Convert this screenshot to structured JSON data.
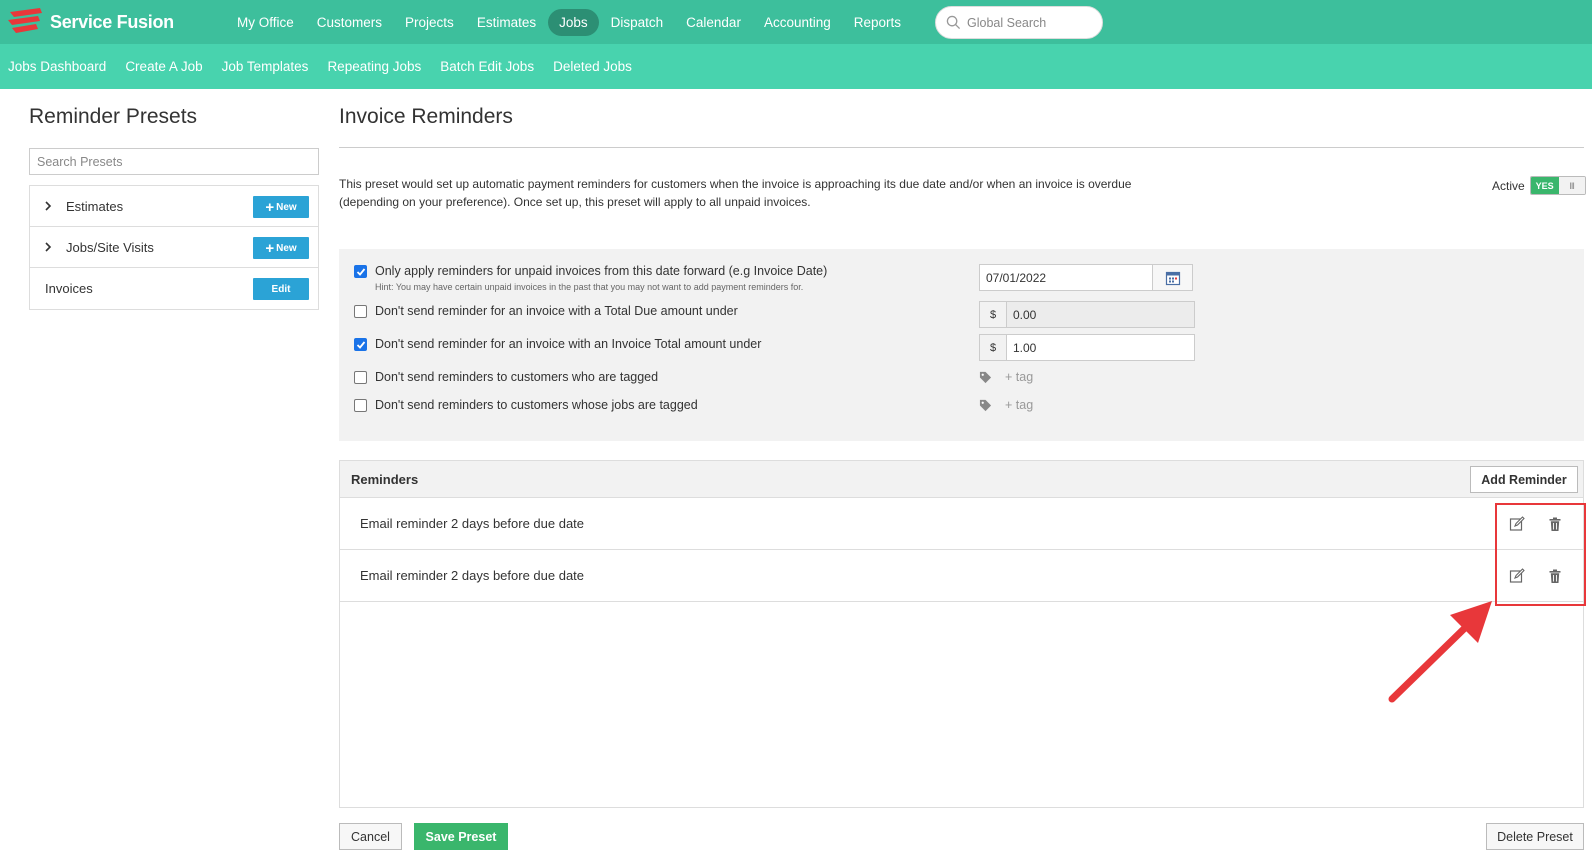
{
  "brand": {
    "name": "Service Fusion",
    "logo_icon": "service-fusion-logo",
    "accent": "#3dbf9c",
    "accent_light": "#48d3ae",
    "nav_active": "#2c8f74"
  },
  "main_nav": {
    "items": [
      "My Office",
      "Customers",
      "Projects",
      "Estimates",
      "Jobs",
      "Dispatch",
      "Calendar",
      "Accounting",
      "Reports"
    ],
    "active": "Jobs"
  },
  "global_search": {
    "placeholder": "Global Search",
    "icon": "search-icon"
  },
  "sub_nav": {
    "items": [
      "Jobs Dashboard",
      "Create A Job",
      "Job Templates",
      "Repeating Jobs",
      "Batch Edit Jobs",
      "Deleted Jobs"
    ]
  },
  "left_panel": {
    "title": "Reminder Presets",
    "search_placeholder": "Search Presets",
    "presets": [
      {
        "label": "Estimates",
        "expandable": true,
        "button": "New"
      },
      {
        "label": "Jobs/Site Visits",
        "expandable": true,
        "button": "New"
      },
      {
        "label": "Invoices",
        "expandable": false,
        "button": "Edit"
      }
    ]
  },
  "main": {
    "title": "Invoice Reminders",
    "description": "This preset would set up automatic payment reminders for customers when the invoice is approaching its due date and/or when an invoice is overdue (depending on your preference). Once set up, this preset will apply to all unpaid invoices.",
    "active_label": "Active",
    "active_toggle": "YES",
    "active_toggle_grip": "III",
    "options": [
      {
        "label": "Only apply reminders for unpaid invoices from this date forward (e.g Invoice Date)",
        "checked": true,
        "hint": "Hint: You may have certain unpaid invoices in the past that you may not want to add payment reminders for."
      },
      {
        "label": "Don't send reminder for an invoice with a Total Due amount under",
        "checked": false
      },
      {
        "label": "Don't send reminder for an invoice with an Invoice Total amount under",
        "checked": true
      },
      {
        "label": "Don't send reminders to customers who are tagged",
        "checked": false
      },
      {
        "label": "Don't send reminders to customers whose jobs are tagged",
        "checked": false
      }
    ],
    "date_value": "07/01/2022",
    "currency_symbol": "$",
    "total_due_value": "0.00",
    "invoice_total_value": "1.00",
    "tag_add_label": "+ tag",
    "reminders": {
      "title": "Reminders",
      "add_label": "Add Reminder",
      "rows": [
        "Email reminder 2 days before due date",
        "Email reminder 2 days before due date"
      ]
    },
    "footer": {
      "cancel": "Cancel",
      "save": "Save Preset",
      "delete": "Delete Preset"
    }
  },
  "annotation_color": "#e8373a"
}
